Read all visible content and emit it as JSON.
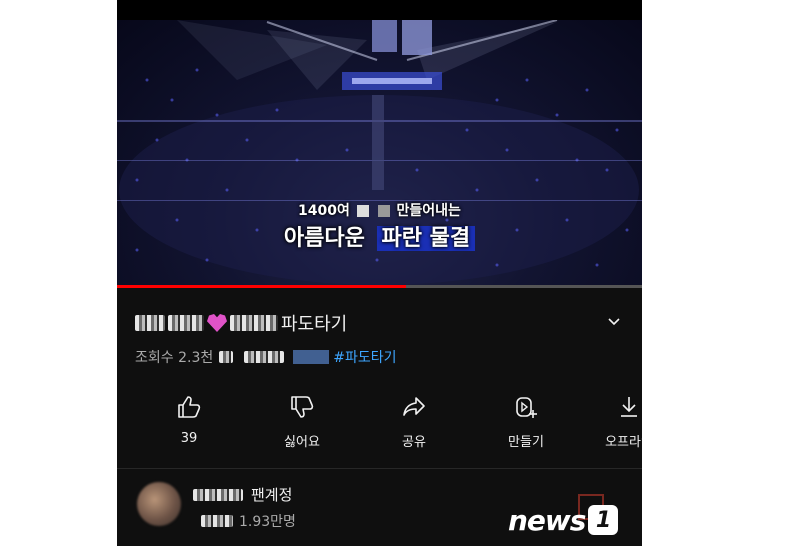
{
  "video": {
    "caption_line1_a": "1400여",
    "caption_line1_b": "만들어내는",
    "caption_line2_a": "아름다운",
    "caption_line2_b": "파란 물결",
    "progress": 0.55,
    "accent_color": "#1a2fb5"
  },
  "title": {
    "text": "파도타기",
    "expand_icon": "chevron-down-icon"
  },
  "meta": {
    "views": "조회수 2.3천",
    "hashtag": "#파도타기"
  },
  "actions": [
    {
      "icon": "thumbs-up-icon",
      "label": "39"
    },
    {
      "icon": "thumbs-down-icon",
      "label": "싫어요"
    },
    {
      "icon": "share-icon",
      "label": "공유"
    },
    {
      "icon": "remix-icon",
      "label": "만들기"
    },
    {
      "icon": "download-icon",
      "label": "오프라인"
    }
  ],
  "channel": {
    "name": "팬계정",
    "subscribers": "1.93만명"
  },
  "watermark": {
    "text": "news",
    "number": "1"
  },
  "colors": {
    "background": "#0f0f0f",
    "progress": "#ff0000",
    "hashtag": "#3ea6ff"
  }
}
